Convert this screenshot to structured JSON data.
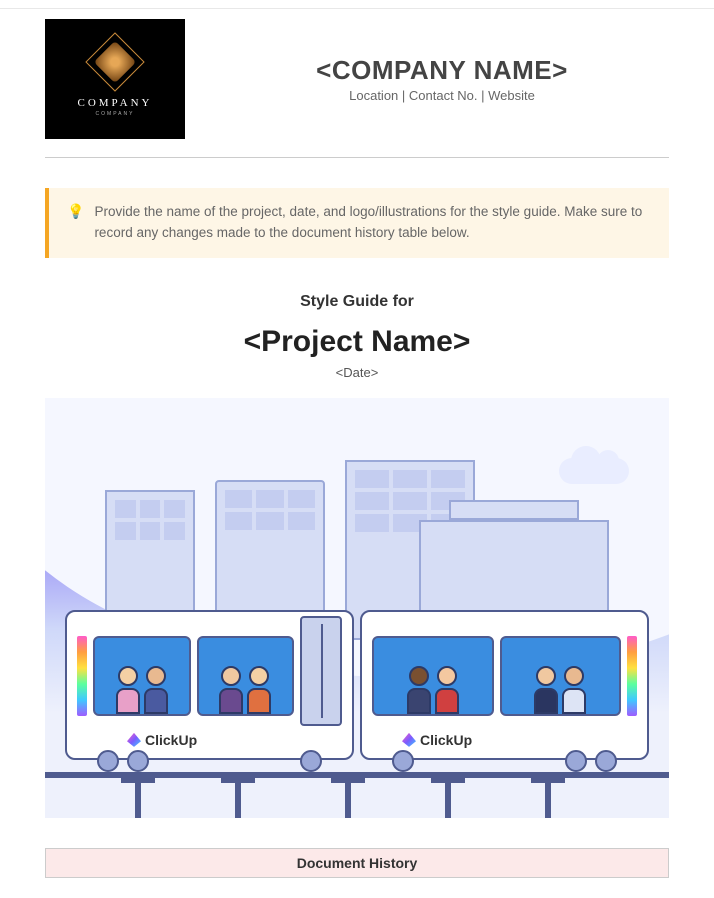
{
  "header": {
    "logo_text": "COMPANY",
    "logo_sub": "COMPANY",
    "company_name": "<COMPANY NAME>",
    "company_sub": "Location | Contact No. | Website"
  },
  "callout": {
    "text": "Provide the name of the project, date, and logo/illustrations for the style guide. Make sure to record any changes made to the document history table below."
  },
  "title": {
    "style_guide_for": "Style Guide for",
    "project_name": "<Project Name>",
    "date": "<Date>"
  },
  "illustration": {
    "brand_label": "ClickUp"
  },
  "sections": {
    "document_history": "Document History"
  }
}
